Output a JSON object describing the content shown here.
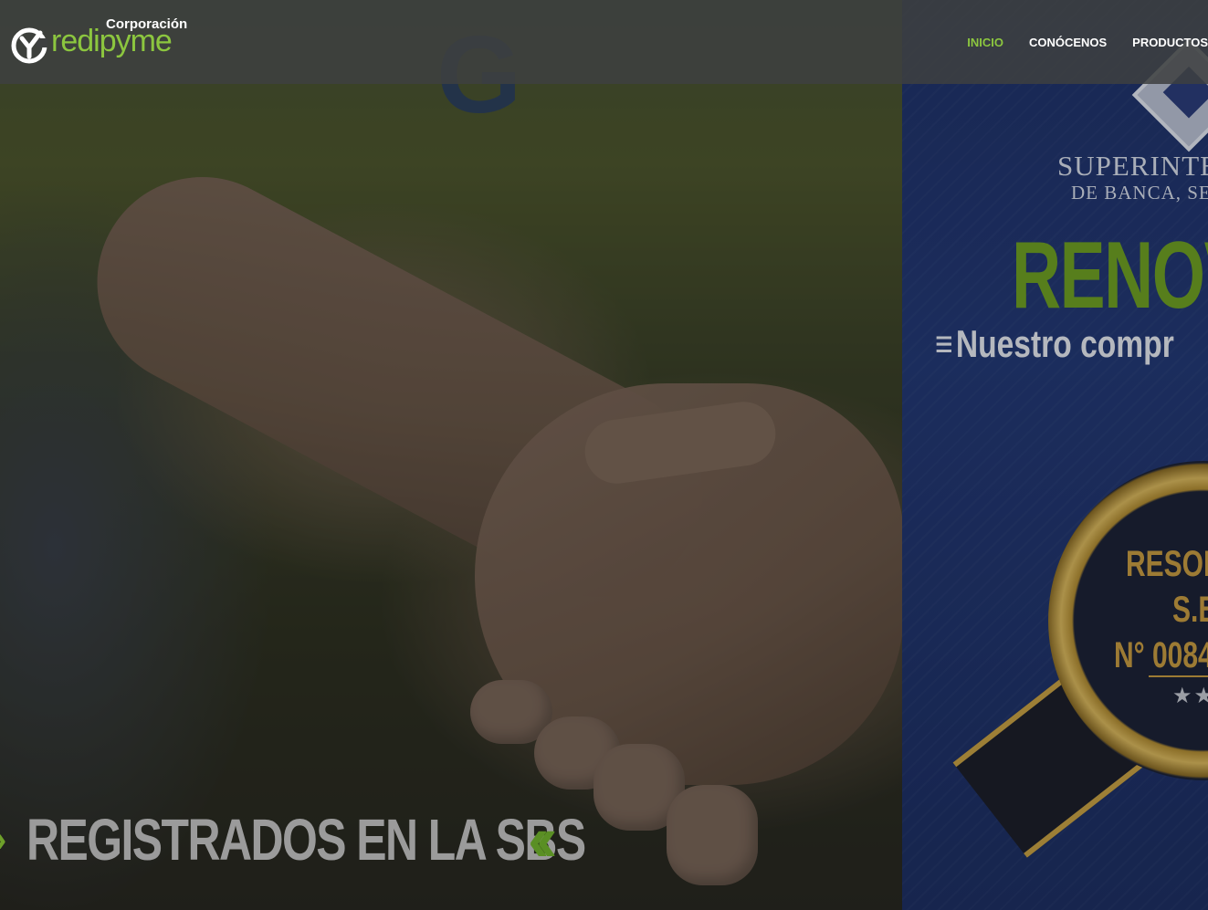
{
  "brand": {
    "corp_label": "Corporación",
    "name": "redipyme",
    "colors": {
      "accent_green": "#8cc63f",
      "navbar_bg": "#3e4040",
      "sbs_blue": "#213672"
    }
  },
  "nav": {
    "items": [
      {
        "label": "INICIO",
        "active": true
      },
      {
        "label": "CONÓCENOS",
        "active": false
      },
      {
        "label": "PRODUCTOS",
        "active": false
      }
    ]
  },
  "hero": {
    "slogan": "REGISTRADOS EN LA SBS",
    "slogan_arrows": "«",
    "sbs_panel": {
      "line1": "SUPERINTE",
      "line2": "DE BANCA, SE",
      "headline": "RENOV",
      "subhead": "Nuestro compr",
      "badge_line1": "RESOL",
      "badge_line2": "S.B",
      "badge_line3": "N° 0084",
      "stars": "★★"
    }
  }
}
